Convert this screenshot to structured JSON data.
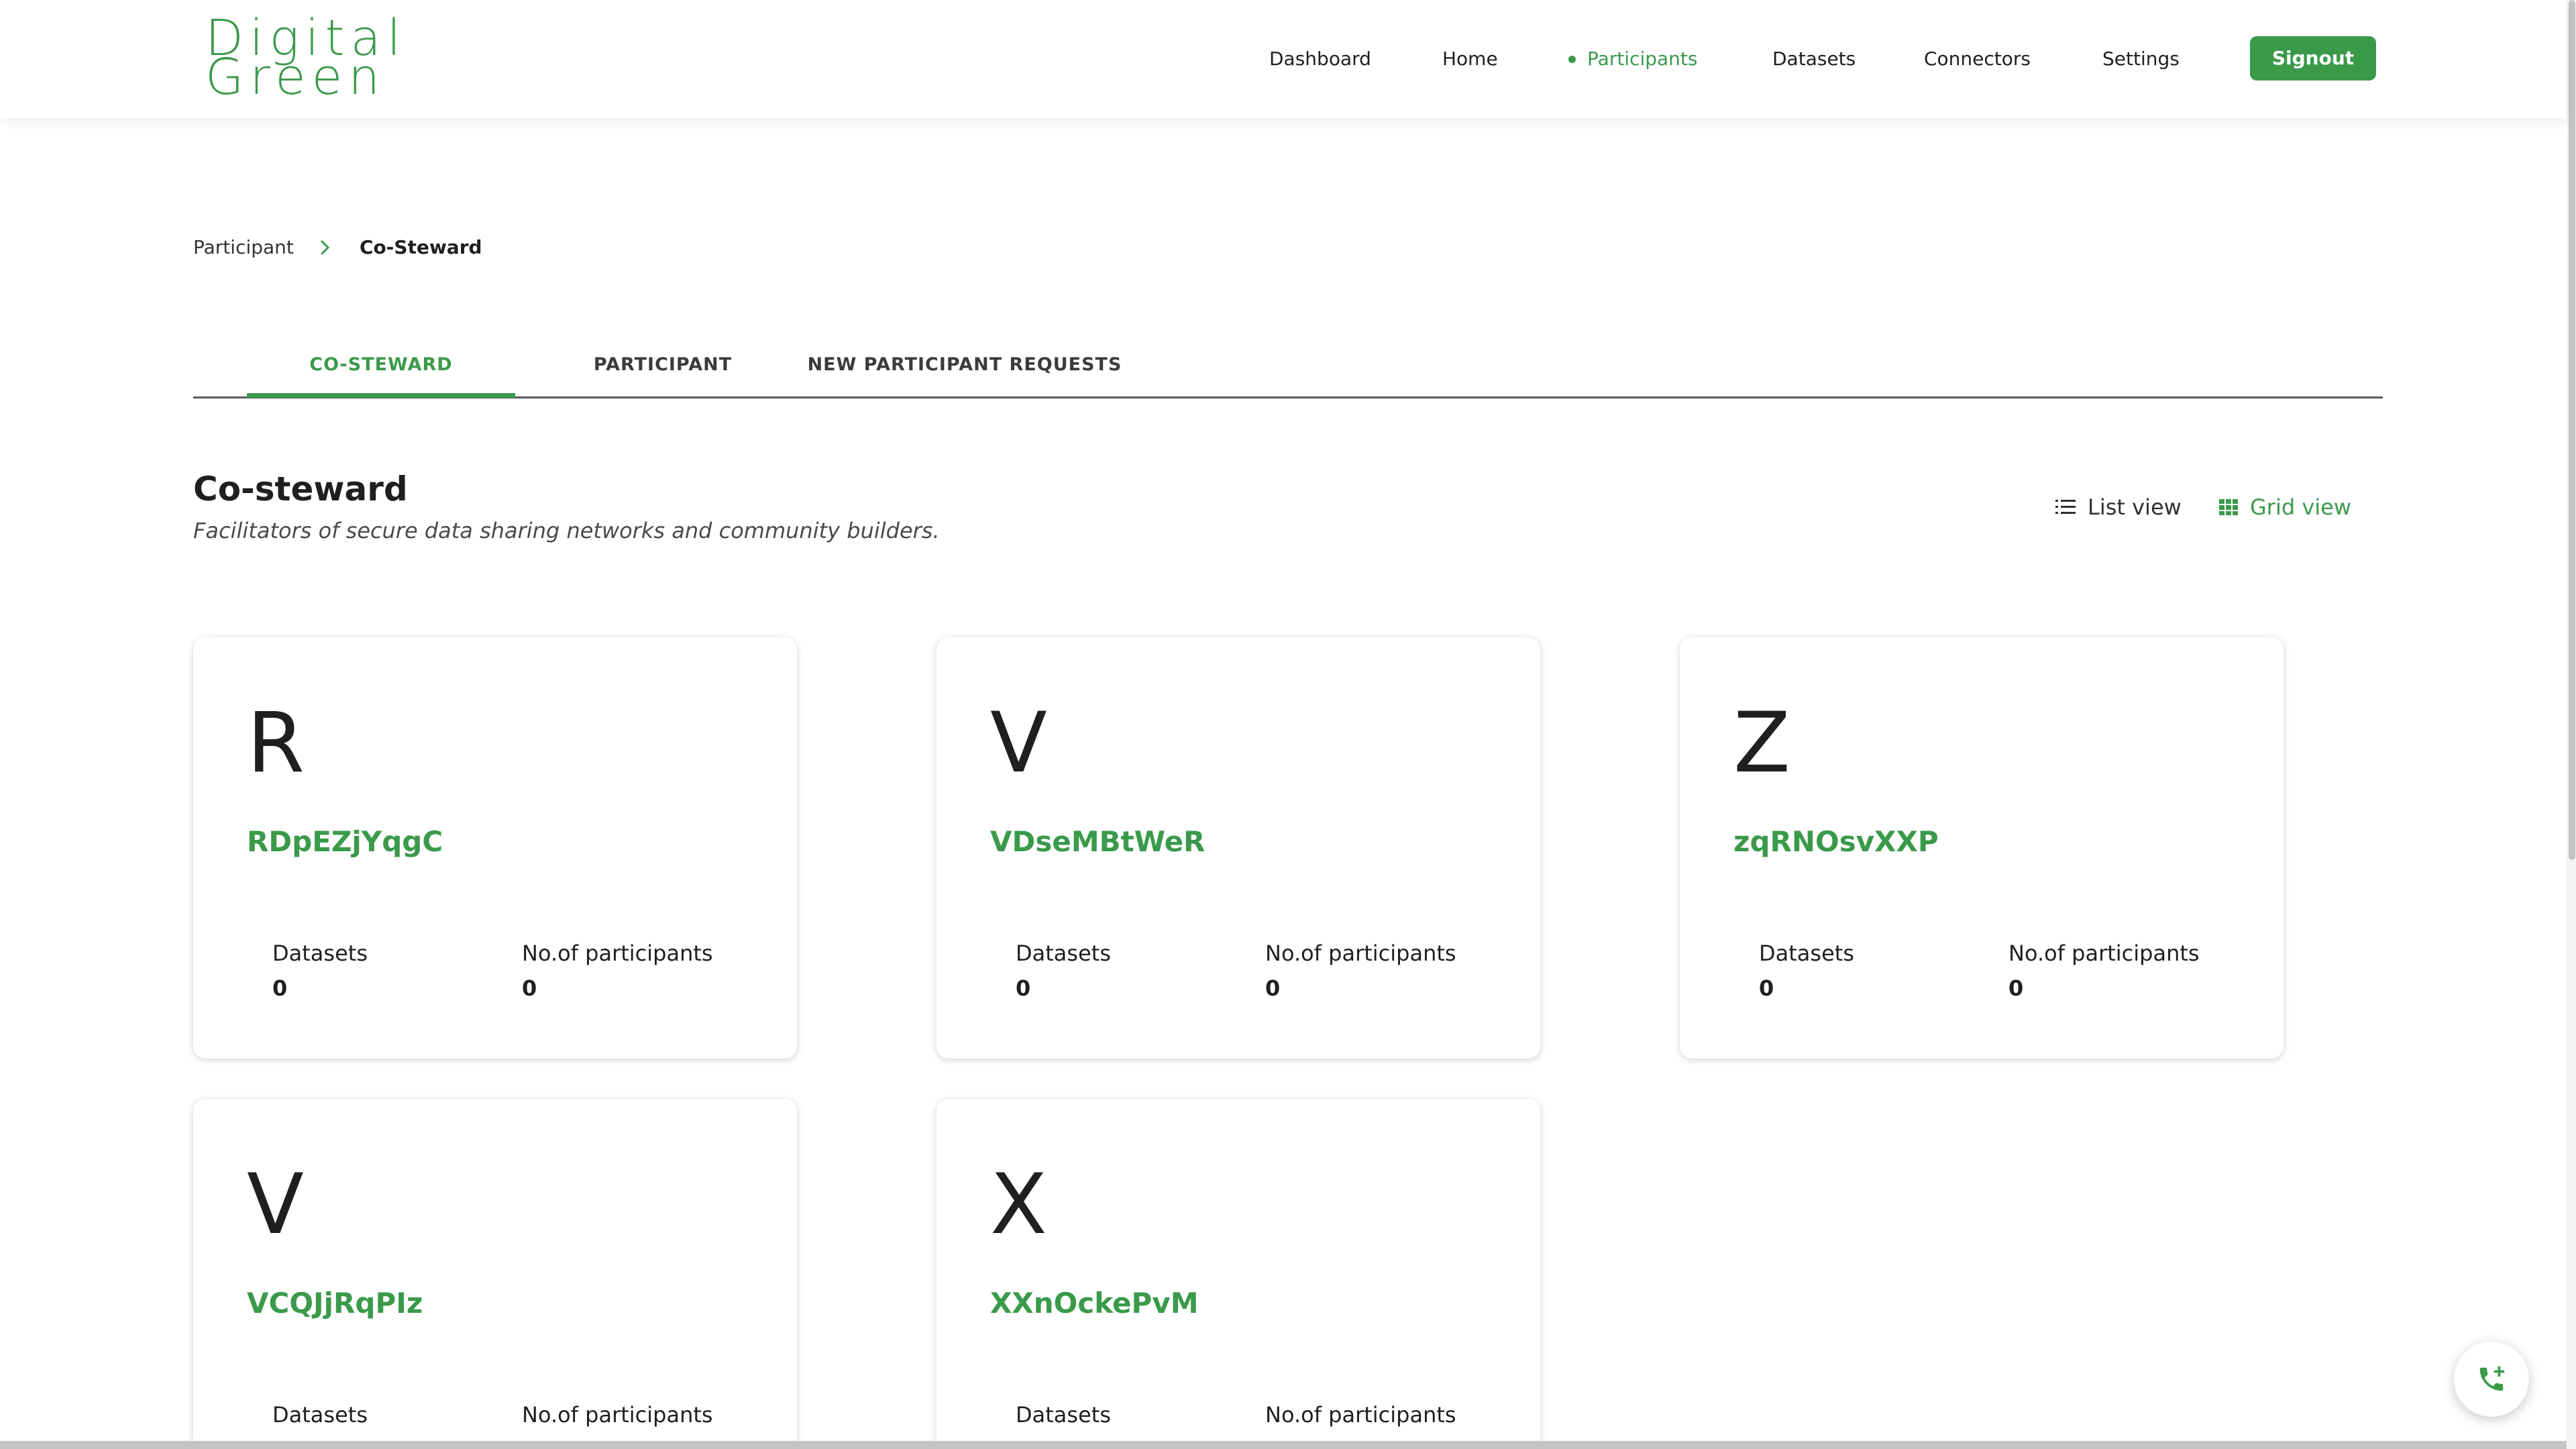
{
  "brand": {
    "line1": "Digital",
    "line2": "Green"
  },
  "nav": {
    "items": [
      {
        "label": "Dashboard"
      },
      {
        "label": "Home"
      },
      {
        "label": "Participants",
        "active": true
      },
      {
        "label": "Datasets"
      },
      {
        "label": "Connectors"
      },
      {
        "label": "Settings"
      }
    ],
    "signout_label": "Signout"
  },
  "breadcrumb": {
    "root": "Participant",
    "current": "Co-Steward"
  },
  "tabs": [
    {
      "label": "CO-STEWARD",
      "active": true
    },
    {
      "label": "PARTICIPANT"
    },
    {
      "label": "NEW PARTICIPANT REQUESTS"
    }
  ],
  "section": {
    "title": "Co-steward",
    "subtitle": "Facilitators of secure data sharing networks and community builders."
  },
  "views": {
    "list_label": "List view",
    "grid_label": "Grid view",
    "selected": "grid"
  },
  "stat_labels": {
    "datasets": "Datasets",
    "participants": "No.of participants"
  },
  "cards": [
    {
      "initial": "R",
      "name": "RDpEZjYqgC",
      "datasets": "0",
      "participants": "0"
    },
    {
      "initial": "V",
      "name": "VDseMBtWeR",
      "datasets": "0",
      "participants": "0"
    },
    {
      "initial": "Z",
      "name": "zqRNOsvXXP",
      "datasets": "0",
      "participants": "0"
    },
    {
      "initial": "V",
      "name": "VCQJjRqPIz"
    },
    {
      "initial": "X",
      "name": "XXnOckePvM"
    }
  ],
  "colors": {
    "accent": "#3a9a4a",
    "text": "#1f1f1f"
  },
  "icons": {
    "list_view": "list-icon",
    "grid_view": "grid-icon",
    "fab": "phone-add-icon",
    "breadcrumb_sep": "chevron-right-icon"
  }
}
